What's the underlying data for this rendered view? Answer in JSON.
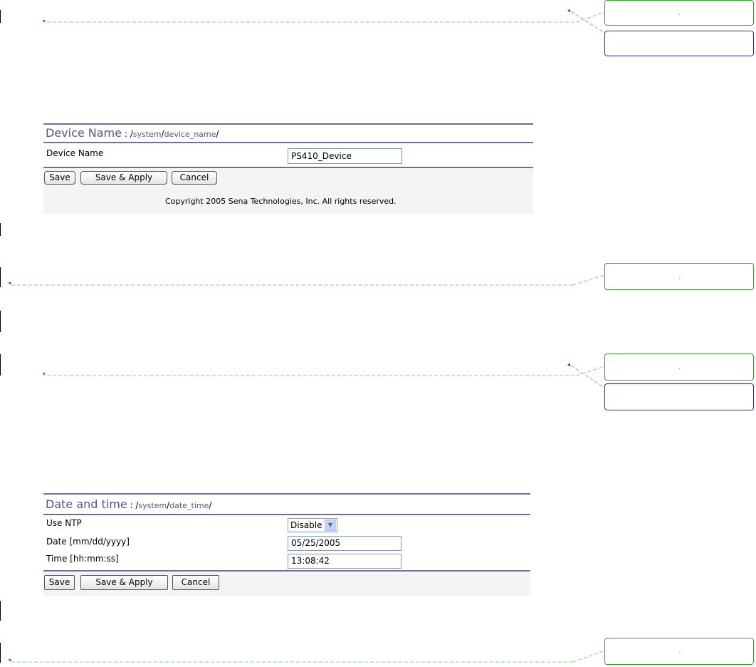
{
  "device_name_panel": {
    "title": "Device Name",
    "separator": " : /",
    "path_system": "system",
    "slash1": "/",
    "path_leaf": "device_name",
    "slash2": "/",
    "row_label": "Device Name",
    "row_value": "PS410_Device",
    "buttons": {
      "save": "Save",
      "save_apply": "Save & Apply",
      "cancel": "Cancel"
    },
    "copyright": "Copyright 2005 Sena Technologies, Inc. All rights reserved."
  },
  "date_time_panel": {
    "title": "Date and time",
    "separator": " : /",
    "path_system": "system",
    "slash1": "/",
    "path_leaf": "date_time",
    "slash2": "/",
    "rows": [
      {
        "label": "Use NTP",
        "value": "Disable"
      },
      {
        "label": "Date [mm/dd/yyyy]",
        "value": "05/25/2005"
      },
      {
        "label": "Time [hh:mm:ss]",
        "value": "13:08:42"
      }
    ],
    "buttons": {
      "save": "Save",
      "save_apply": "Save & Apply",
      "cancel": "Cancel"
    }
  },
  "colors": {
    "accent_border": "#6f6d9c",
    "title_text": "#55558a",
    "comment_green": "#3aa03a",
    "comment_blue": "#2a2acc"
  },
  "icons": {
    "select_arrow": "chevron-down-icon"
  }
}
